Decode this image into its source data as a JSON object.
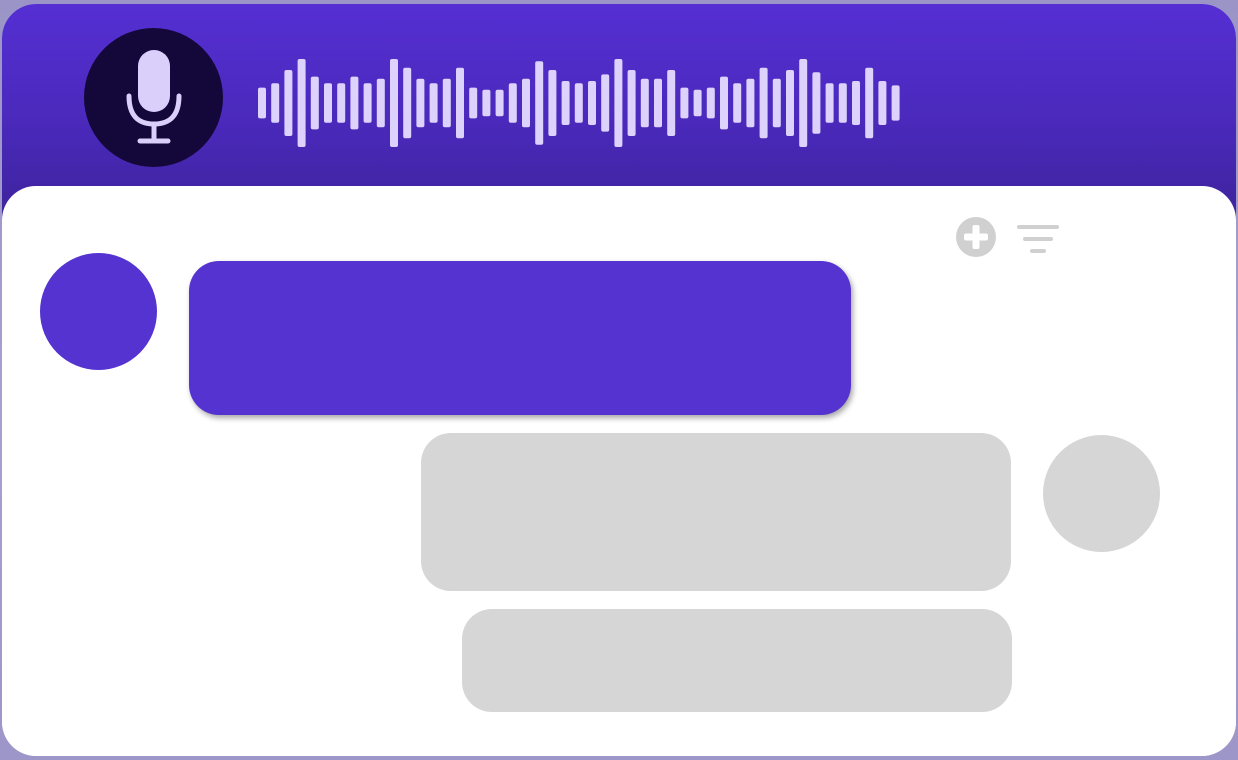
{
  "colors": {
    "accent": "#5533d1",
    "header_dark": "#3e239c",
    "mic_bg": "#130839",
    "mic_fg": "#d9cffa",
    "wave": "#dcd2fb",
    "placeholder": "#d6d6d6",
    "toolbar_icon": "#d0d0d0"
  },
  "header": {
    "mic_icon": "microphone-icon",
    "waveform_icon": "audio-waveform",
    "waveform_levels": [
      0.35,
      0.45,
      0.75,
      1.0,
      0.6,
      0.45,
      0.45,
      0.6,
      0.45,
      0.55,
      1.0,
      0.8,
      0.55,
      0.45,
      0.55,
      0.8,
      0.35,
      0.3,
      0.3,
      0.45,
      0.55,
      0.95,
      0.75,
      0.5,
      0.45,
      0.5,
      0.65,
      1.0,
      0.75,
      0.55,
      0.55,
      0.75,
      0.35,
      0.3,
      0.35,
      0.6,
      0.45,
      0.55,
      0.8,
      0.55,
      0.75,
      1.0,
      0.7,
      0.45,
      0.45,
      0.5,
      0.8,
      0.5,
      0.4
    ]
  },
  "toolbar": {
    "add_icon": "plus-circle-icon",
    "filter_icon": "filter-lines-icon"
  },
  "messages": [
    {
      "side": "incoming",
      "kind": "accent"
    },
    {
      "side": "outgoing",
      "kind": "placeholder"
    },
    {
      "side": "outgoing",
      "kind": "placeholder"
    }
  ]
}
